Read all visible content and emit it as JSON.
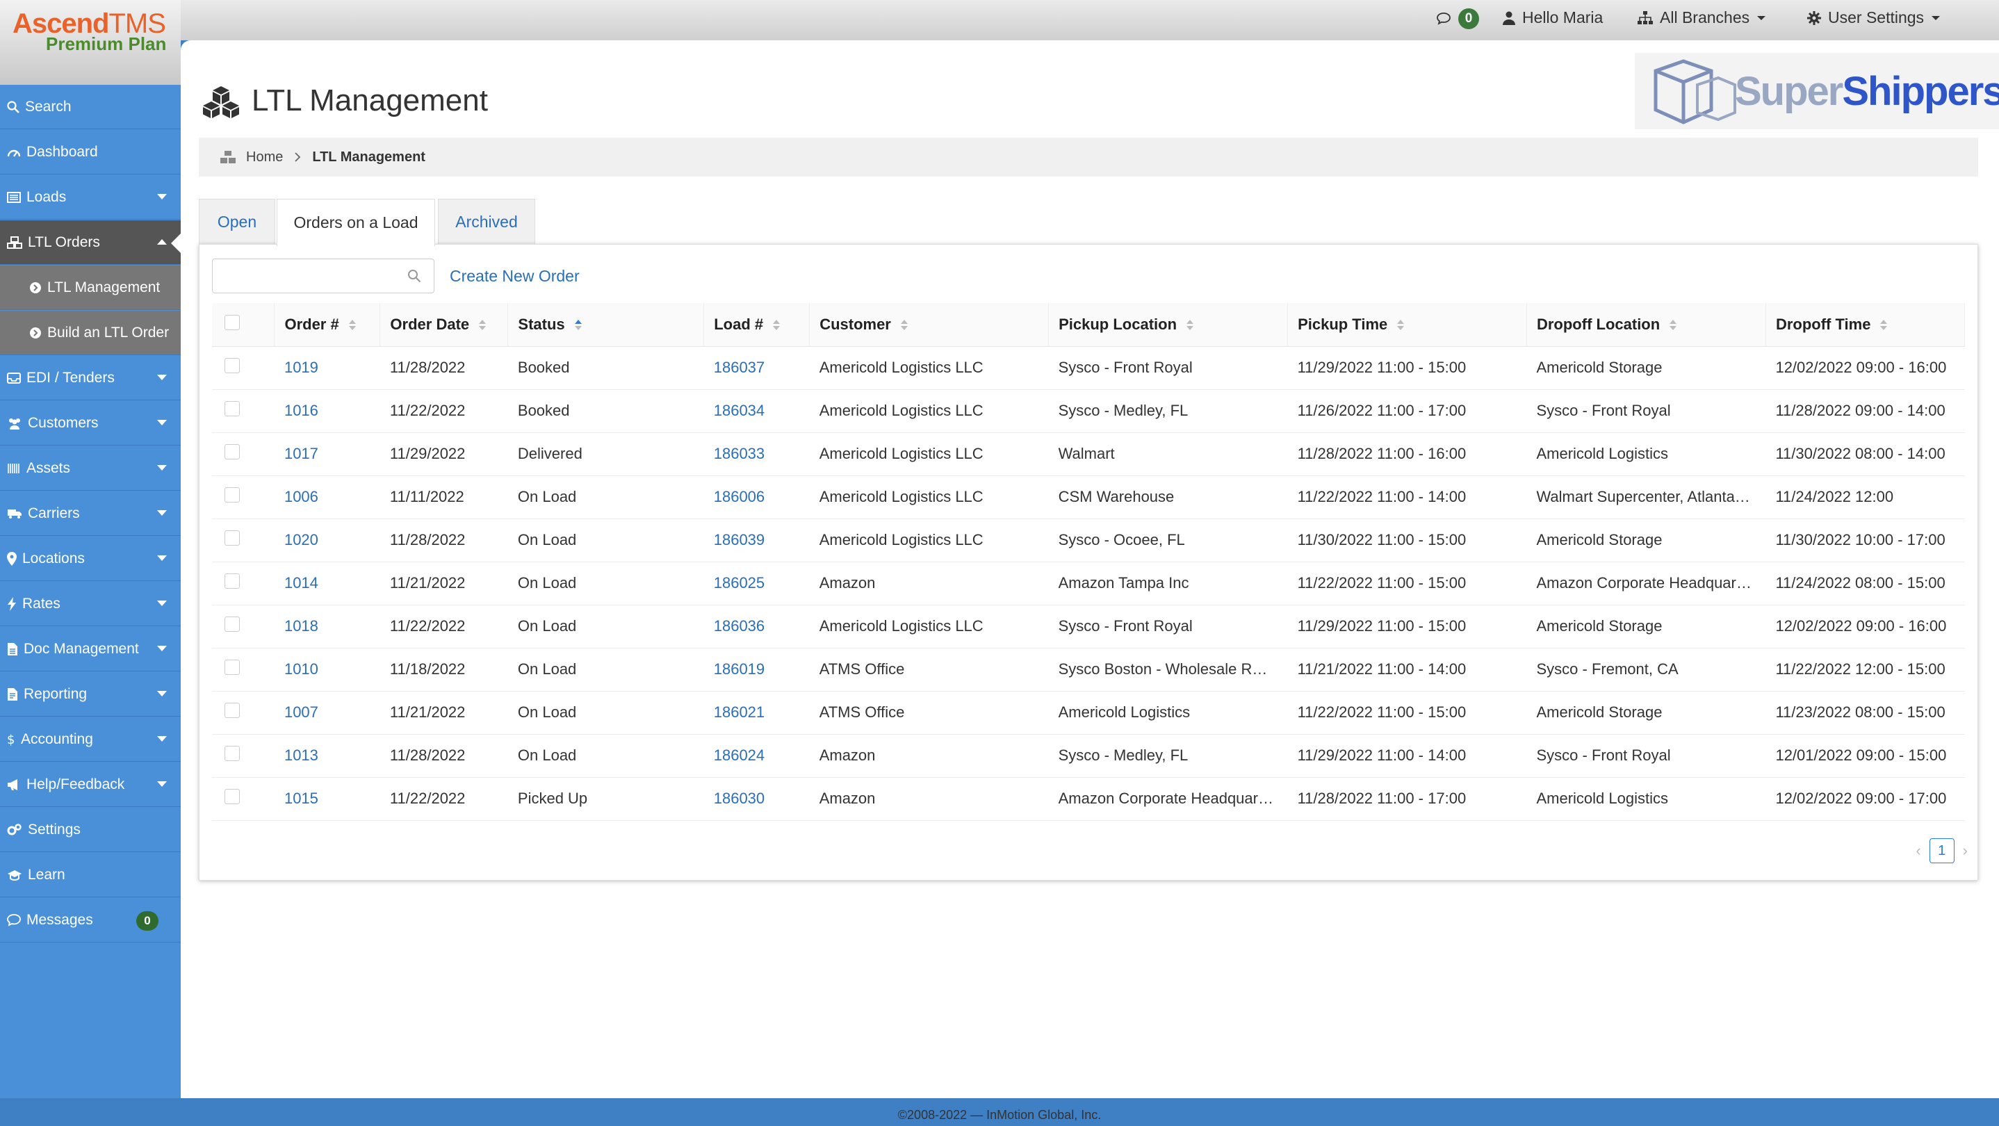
{
  "app": {
    "logo_word1": "Ascend",
    "logo_word2": "TMS",
    "plan": "Premium Plan"
  },
  "topbar": {
    "messages_count": "0",
    "greeting": "Hello Maria",
    "branches": "All Branches",
    "user_settings": "User Settings"
  },
  "sidebar": {
    "items": [
      {
        "label": "Search"
      },
      {
        "label": "Dashboard"
      },
      {
        "label": "Loads"
      },
      {
        "label": "LTL Orders"
      },
      {
        "label": "LTL Management"
      },
      {
        "label": "Build an LTL Order"
      },
      {
        "label": "EDI / Tenders"
      },
      {
        "label": "Customers"
      },
      {
        "label": "Assets"
      },
      {
        "label": "Carriers"
      },
      {
        "label": "Locations"
      },
      {
        "label": "Rates"
      },
      {
        "label": "Doc Management"
      },
      {
        "label": "Reporting"
      },
      {
        "label": "Accounting"
      },
      {
        "label": "Help/Feedback"
      },
      {
        "label": "Settings"
      },
      {
        "label": "Learn"
      },
      {
        "label": "Messages",
        "count": "0"
      }
    ]
  },
  "page": {
    "title": "LTL Management",
    "brand_word1": "Super",
    "brand_word2": "Shippers"
  },
  "breadcrumb": {
    "home": "Home",
    "current": "LTL Management"
  },
  "tabs": [
    {
      "label": "Open"
    },
    {
      "label": "Orders on a Load"
    },
    {
      "label": "Archived"
    }
  ],
  "toolbar": {
    "search_placeholder": "",
    "create_label": "Create New Order"
  },
  "table": {
    "columns": [
      "Order #",
      "Order Date",
      "Status",
      "Load #",
      "Customer",
      "Pickup Location",
      "Pickup Time",
      "Dropoff Location",
      "Dropoff Time"
    ],
    "rows": [
      [
        "1019",
        "11/28/2022",
        "Booked",
        "186037",
        "Americold Logistics LLC",
        "Sysco - Front Royal",
        "11/29/2022 11:00 - 15:00",
        "Americold Storage",
        "12/02/2022 09:00 - 16:00"
      ],
      [
        "1016",
        "11/22/2022",
        "Booked",
        "186034",
        "Americold Logistics LLC",
        "Sysco - Medley, FL",
        "11/26/2022 11:00 - 17:00",
        "Sysco - Front Royal",
        "11/28/2022 09:00 - 14:00"
      ],
      [
        "1017",
        "11/29/2022",
        "Delivered",
        "186033",
        "Americold Logistics LLC",
        "Walmart",
        "11/28/2022 11:00 - 16:00",
        "Americold Logistics",
        "11/30/2022 08:00 - 14:00"
      ],
      [
        "1006",
        "11/11/2022",
        "On Load",
        "186006",
        "Americold Logistics LLC",
        "CSM Warehouse",
        "11/22/2022 11:00 - 14:00",
        "Walmart Supercenter, Atlanta…",
        "11/24/2022 12:00"
      ],
      [
        "1020",
        "11/28/2022",
        "On Load",
        "186039",
        "Americold Logistics LLC",
        "Sysco - Ocoee, FL",
        "11/30/2022 11:00 - 15:00",
        "Americold Storage",
        "11/30/2022 10:00 - 17:00"
      ],
      [
        "1014",
        "11/21/2022",
        "On Load",
        "186025",
        "Amazon",
        "Amazon Tampa Inc",
        "11/22/2022 11:00 - 15:00",
        "Amazon Corporate Headquar…",
        "11/24/2022 08:00 - 15:00"
      ],
      [
        "1018",
        "11/22/2022",
        "On Load",
        "186036",
        "Americold Logistics LLC",
        "Sysco - Front Royal",
        "11/29/2022 11:00 - 15:00",
        "Americold Storage",
        "12/02/2022 09:00 - 16:00"
      ],
      [
        "1010",
        "11/18/2022",
        "On Load",
        "186019",
        "ATMS Office",
        "Sysco Boston - Wholesale R…",
        "11/21/2022 11:00 - 14:00",
        "Sysco - Fremont, CA",
        "11/22/2022 12:00 - 15:00"
      ],
      [
        "1007",
        "11/21/2022",
        "On Load",
        "186021",
        "ATMS Office",
        "Americold Logistics",
        "11/22/2022 11:00 - 15:00",
        "Americold Storage",
        "11/23/2022 08:00 - 15:00"
      ],
      [
        "1013",
        "11/28/2022",
        "On Load",
        "186024",
        "Amazon",
        "Sysco - Medley, FL",
        "11/29/2022 11:00 - 14:00",
        "Sysco - Front Royal",
        "12/01/2022 09:00 - 15:00"
      ],
      [
        "1015",
        "11/22/2022",
        "Picked Up",
        "186030",
        "Amazon",
        "Amazon Corporate Headquar…",
        "11/28/2022 11:00 - 17:00",
        "Americold Logistics",
        "12/02/2022 09:00 - 17:00"
      ]
    ]
  },
  "pager": {
    "current_page": "1"
  },
  "footer": {
    "text": "©2008-2022 — InMotion Global, Inc."
  }
}
